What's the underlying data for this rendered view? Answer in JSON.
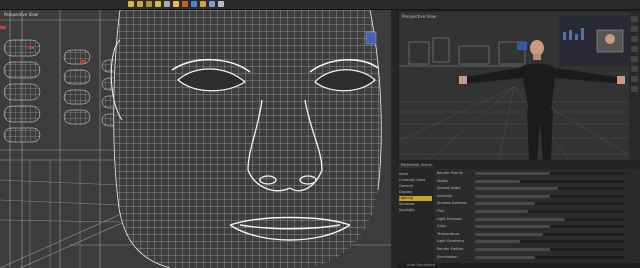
{
  "toolbar": {
    "tools": [
      {
        "icon": "universal-tool-icon",
        "color": "#d6b83a"
      },
      {
        "icon": "move-tool-icon",
        "color": "#c9a93a"
      },
      {
        "icon": "rotate-tool-icon",
        "color": "#b9923a"
      },
      {
        "icon": "scale-tool-icon",
        "color": "#d2c04a"
      },
      {
        "icon": "camera-tool-icon",
        "color": "#a9a9a9"
      },
      {
        "icon": "light-tool-icon",
        "color": "#e0c050"
      },
      {
        "icon": "geometry-tool-icon",
        "color": "#c06030"
      },
      {
        "icon": "render-icon",
        "color": "#4a86c8"
      },
      {
        "icon": "render-settings-icon",
        "color": "#c9a93a"
      },
      {
        "icon": "iray-preview-icon",
        "color": "#70a0d0"
      },
      {
        "icon": "select-tool-icon",
        "color": "#bbbbbb"
      }
    ]
  },
  "viewport_left": {
    "label": "Perspective View",
    "background": "#3a3a3a",
    "wire_color": "#e8e8e8"
  },
  "viewport_right": {
    "label": "Perspective View",
    "figure_color": "#1b1b1b",
    "skin_color": "#c79b82"
  },
  "params": {
    "tabs": [
      "Parameters",
      "Scene"
    ],
    "tree": [
      {
        "label": "Actor"
      },
      {
        "label": "Currently Used"
      },
      {
        "label": "General"
      },
      {
        "label": "Display"
      },
      {
        "label": "Lighting",
        "selected": true
      },
      {
        "label": "Shadows"
      },
      {
        "label": "Spotlight"
      }
    ],
    "rows": [
      {
        "label": "Render Priority",
        "value": 0.5
      },
      {
        "label": "Visible",
        "value": 0.3
      },
      {
        "label": "Spread Angle",
        "value": 0.55
      },
      {
        "label": "Intensity",
        "value": 0.5
      },
      {
        "label": "Shadow Softness",
        "value": 0.4
      },
      {
        "label": "Flux",
        "value": 0.35
      },
      {
        "label": "Light Emission",
        "value": 0.6
      },
      {
        "label": "Color",
        "value": 0.5
      },
      {
        "label": "Temperature",
        "value": 0.45
      },
      {
        "label": "Light Geometry",
        "value": 0.3
      },
      {
        "label": "Render Emitter",
        "value": 0.5
      },
      {
        "label": "Illumination",
        "value": 0.4
      }
    ],
    "status": "Auto Generated"
  }
}
